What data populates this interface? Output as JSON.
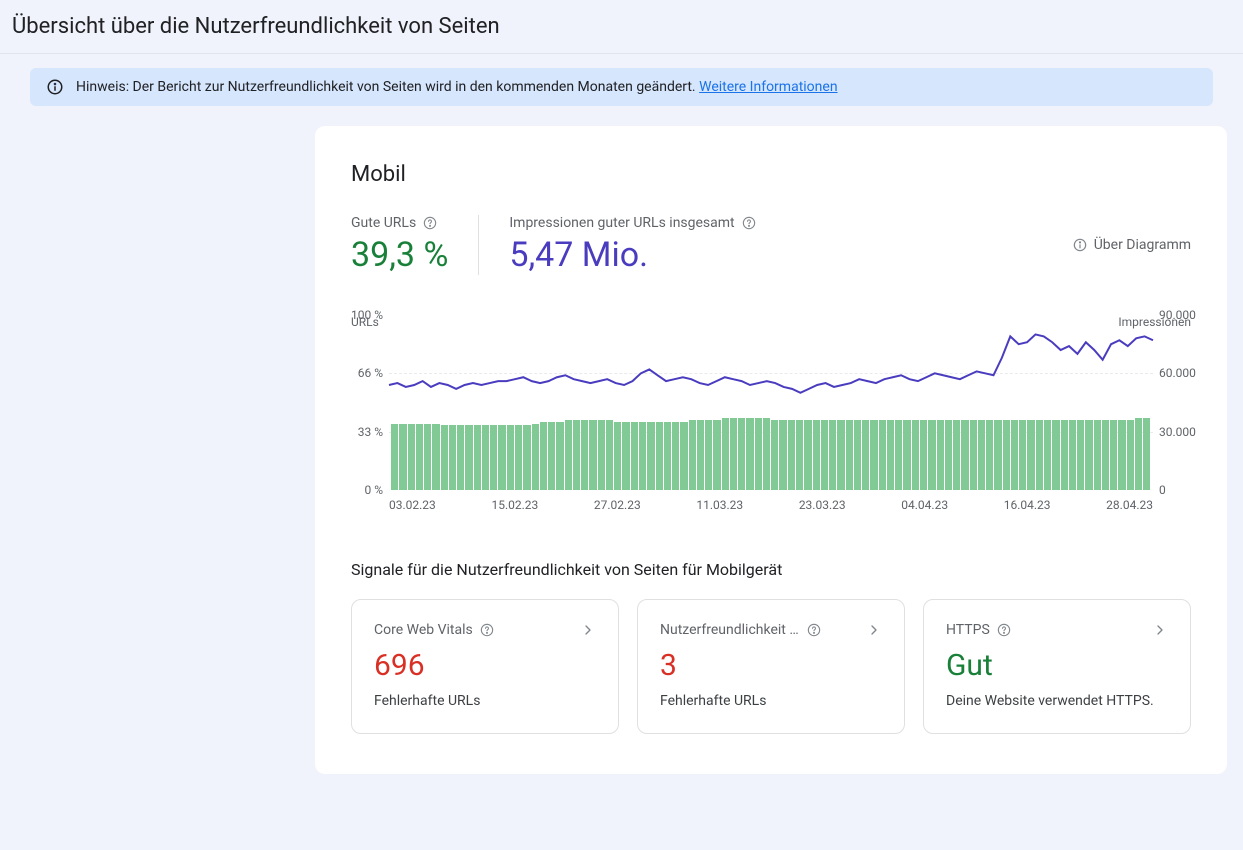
{
  "header": {
    "title": "Übersicht über die Nutzerfreundlichkeit von Seiten"
  },
  "notice": {
    "prefix": "Hinweis: Der Bericht zur Nutzerfreundlichkeit von Seiten wird in den kommenden Monaten geändert. ",
    "link_text": "Weitere Informationen"
  },
  "card": {
    "title": "Mobil",
    "kpi_good_urls": {
      "label": "Gute URLs",
      "value": "39,3 %"
    },
    "kpi_impressions": {
      "label": "Impressionen guter URLs insgesamt",
      "value": "5,47 Mio."
    },
    "about_chart": "Über Diagramm"
  },
  "chart_data": {
    "type": "bar+line",
    "left_axis_title": "URLs",
    "right_axis_title": "Impressionen",
    "y_left_ticks": [
      "100 %",
      "66 %",
      "33 %",
      "0 %"
    ],
    "y_right_ticks": [
      "90.000",
      "60.000",
      "30.000",
      "0"
    ],
    "x_ticks": [
      "03.02.23",
      "15.02.23",
      "27.02.23",
      "11.03.23",
      "23.03.23",
      "04.04.23",
      "16.04.23",
      "28.04.23"
    ],
    "ylim_left_pct": [
      0,
      100
    ],
    "ylim_right": [
      0,
      90000
    ],
    "series": [
      {
        "name": "Gute URLs (%)",
        "axis": "left",
        "type": "bar",
        "values_pct": [
          38,
          38,
          38,
          38,
          38,
          38,
          37,
          37,
          37,
          37,
          37,
          37,
          37,
          37,
          37,
          37,
          37,
          38,
          39,
          39,
          39,
          40,
          40,
          40,
          40,
          40,
          40,
          39,
          39,
          39,
          39,
          39,
          39,
          39,
          39,
          39,
          40,
          40,
          40,
          40,
          41,
          41,
          41,
          41,
          41,
          41,
          40,
          40,
          40,
          40,
          40,
          40,
          40,
          40,
          40,
          40,
          40,
          40,
          40,
          40,
          40,
          40,
          40,
          40,
          40,
          40,
          40,
          40,
          40,
          40,
          40,
          40,
          40,
          40,
          40,
          40,
          40,
          40,
          40,
          40,
          40,
          40,
          40,
          40,
          40,
          40,
          40,
          40,
          40,
          40,
          41,
          41
        ]
      },
      {
        "name": "Impressionen",
        "axis": "right",
        "type": "line",
        "values": [
          54000,
          55000,
          53000,
          54000,
          56000,
          53000,
          55000,
          54000,
          52000,
          54000,
          55000,
          54000,
          55000,
          56000,
          56000,
          57000,
          58000,
          56000,
          55000,
          56000,
          58000,
          59000,
          57000,
          56000,
          55000,
          56000,
          57000,
          55000,
          54000,
          56000,
          60000,
          62000,
          59000,
          56000,
          57000,
          58000,
          57000,
          55000,
          54000,
          56000,
          58000,
          57000,
          56000,
          54000,
          55000,
          56000,
          55000,
          53000,
          52000,
          50000,
          52000,
          54000,
          55000,
          53000,
          54000,
          55000,
          57000,
          56000,
          55000,
          57000,
          58000,
          59000,
          57000,
          56000,
          58000,
          60000,
          59000,
          58000,
          57000,
          59000,
          61000,
          60000,
          59000,
          68000,
          79000,
          75000,
          76000,
          80000,
          79000,
          76000,
          72000,
          74000,
          70000,
          76000,
          72000,
          67000,
          75000,
          77000,
          74000,
          78000,
          79000,
          77000
        ]
      }
    ]
  },
  "signals": {
    "section_title": "Signale für die Nutzerfreundlichkeit von Seiten für Mobilgerät",
    "cards": [
      {
        "title": "Core Web Vitals",
        "value": "696",
        "value_class": "red",
        "subtitle": "Fehlerhafte URLs"
      },
      {
        "title": "Nutzerfreundlichkeit a...",
        "value": "3",
        "value_class": "red",
        "subtitle": "Fehlerhafte URLs"
      },
      {
        "title": "HTTPS",
        "value": "Gut",
        "value_class": "green",
        "subtitle": "Deine Website verwendet HTTPS."
      }
    ]
  }
}
